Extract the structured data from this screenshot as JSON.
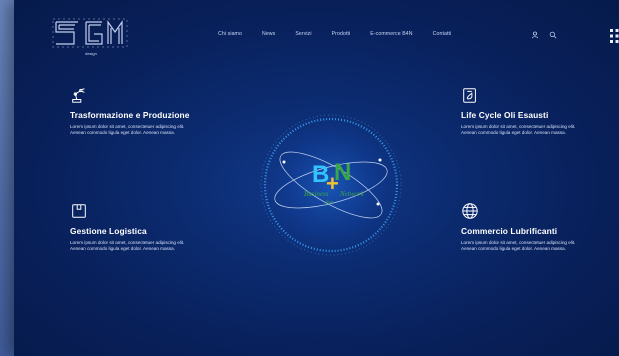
{
  "brand": {
    "logo_text": "SGM",
    "logo_subtext": "design"
  },
  "nav": {
    "items": [
      {
        "label": "Chi siamo"
      },
      {
        "label": "News"
      },
      {
        "label": "Servizi"
      },
      {
        "label": "Prodotti"
      },
      {
        "label": "E-commerce B4N"
      },
      {
        "label": "Contatti"
      }
    ],
    "icons": [
      "user-icon",
      "search-icon",
      "grid-menu-icon"
    ]
  },
  "features": [
    {
      "title": "Trasformazione e  Produzione",
      "text": "Lorem ipsum dolor sit amet, consectetuer adipiscing elit. Aenean commodo ligula eget dolor. Aenean massa.",
      "icon": "robot-arm-icon"
    },
    {
      "title": "Life Cycle Oli Esausti",
      "text": "Lorem ipsum dolor sit amet, consectetuer adipiscing elit. Aenean commodo ligula eget dolor. Aenean massa.",
      "icon": "oil-recycle-icon"
    },
    {
      "title": "Gestione Logistica",
      "text": "Lorem ipsum dolor sit amet, consectetuer adipiscing elit. Aenean commodo ligula eget dolor. Aenean massa.",
      "icon": "box-icon"
    },
    {
      "title": "Commercio Lubrificanti",
      "text": "Lorem ipsum dolor sit amet, consectetuer adipiscing elit. Aenean commodo ligula eget dolor. Aenean massa.",
      "icon": "globe-icon"
    }
  ],
  "center": {
    "logo_b": "B",
    "logo_plus": "+",
    "logo_n": "N",
    "tagline_left": "Business",
    "tagline_right": "Network",
    "tagline_for": "for"
  },
  "colors": {
    "background": "#0b2a6e",
    "text": "#ffffff",
    "accent_cyan": "#33c3ff",
    "accent_green": "#3aa64a",
    "accent_yellow": "#f2c230"
  }
}
